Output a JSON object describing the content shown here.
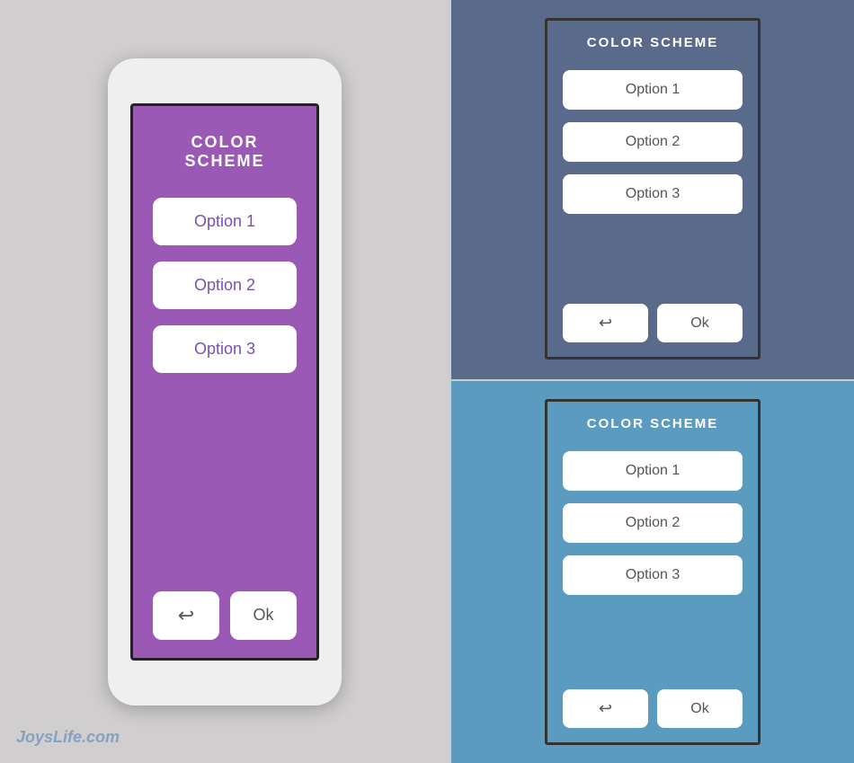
{
  "left": {
    "title": "COLOR SCHEME",
    "options": [
      "Option 1",
      "Option 2",
      "Option 3"
    ],
    "back_arrow": "↩",
    "ok_label": "Ok",
    "bg_color": "#9b59b6"
  },
  "right_top": {
    "title": "COLOR SCHEME",
    "options": [
      "Option 1",
      "Option 2",
      "Option 3"
    ],
    "back_arrow": "↩",
    "ok_label": "Ok",
    "bg_color": "#5a6a8a"
  },
  "right_bottom": {
    "title": "COLOR SCHEME",
    "options": [
      "Option 1",
      "Option 2",
      "Option 3"
    ],
    "back_arrow": "↩",
    "ok_label": "Ok",
    "bg_color": "#5b9bbf"
  },
  "watermark": "JoysLife.com"
}
